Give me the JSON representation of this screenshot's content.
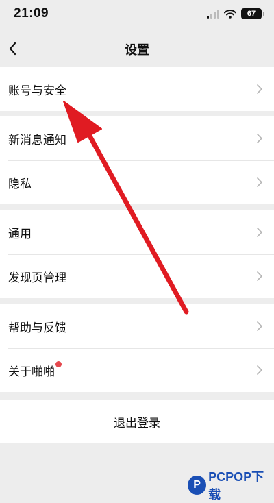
{
  "status_bar": {
    "time": "21:09",
    "battery": "67"
  },
  "nav": {
    "title": "设置"
  },
  "groups": [
    {
      "items": [
        {
          "label": "账号与安全"
        }
      ]
    },
    {
      "items": [
        {
          "label": "新消息通知"
        },
        {
          "label": "隐私"
        }
      ]
    },
    {
      "items": [
        {
          "label": "通用"
        },
        {
          "label": "发现页管理"
        }
      ]
    },
    {
      "items": [
        {
          "label": "帮助与反馈"
        },
        {
          "label": "关于啪啪",
          "badge": "red-dot"
        }
      ]
    }
  ],
  "logout": {
    "label": "退出登录"
  },
  "annotation": {
    "type": "red-arrow",
    "color": "#e01b22",
    "points_to": "账号与安全"
  },
  "watermark": {
    "logo_letter": "P",
    "text": "PCPOP下载"
  },
  "colors": {
    "background": "#ededed",
    "card": "#ffffff",
    "divider": "#e6e6e6",
    "badge": "#e5484d",
    "arrow": "#e01b22"
  }
}
